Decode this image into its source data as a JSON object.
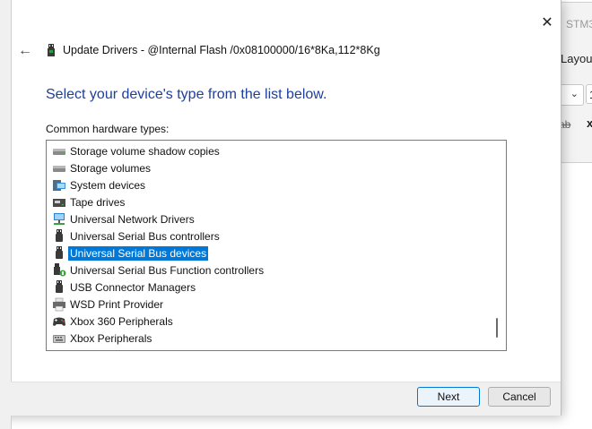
{
  "background_window": {
    "title_fragment": "STM3",
    "layout_fragment": "Layout",
    "input_fragment": "1",
    "ab_label": "ab",
    "x_label": "x"
  },
  "dialog": {
    "title": "Update Drivers - @Internal Flash  /0x08100000/16*8Ka,112*8Kg",
    "heading": "Select your device's type from the list below.",
    "list_label": "Common hardware types:",
    "close_glyph": "✕",
    "back_glyph": "←"
  },
  "hardware_types": [
    {
      "label": "Storage volume shadow copies",
      "icon": "drive-icon",
      "selected": false
    },
    {
      "label": "Storage volumes",
      "icon": "drive-icon",
      "selected": false
    },
    {
      "label": "System devices",
      "icon": "system-devices-icon",
      "selected": false
    },
    {
      "label": "Tape drives",
      "icon": "tape-drive-icon",
      "selected": false
    },
    {
      "label": "Universal Network Drivers",
      "icon": "network-icon",
      "selected": false
    },
    {
      "label": "Universal Serial Bus controllers",
      "icon": "usb-icon",
      "selected": false
    },
    {
      "label": "Universal Serial Bus devices",
      "icon": "usb-icon",
      "selected": true
    },
    {
      "label": "Universal Serial Bus Function controllers",
      "icon": "usb-function-icon",
      "selected": false
    },
    {
      "label": "USB Connector Managers",
      "icon": "usb-icon",
      "selected": false
    },
    {
      "label": "WSD Print Provider",
      "icon": "printer-icon",
      "selected": false
    },
    {
      "label": "Xbox 360 Peripherals",
      "icon": "gamepad-icon",
      "selected": false
    },
    {
      "label": "Xbox Peripherals",
      "icon": "keyboard-icon",
      "selected": false
    }
  ],
  "buttons": {
    "next": "Next",
    "cancel": "Cancel"
  },
  "colors": {
    "heading": "#1f3f9a",
    "selection": "#0078d7"
  }
}
